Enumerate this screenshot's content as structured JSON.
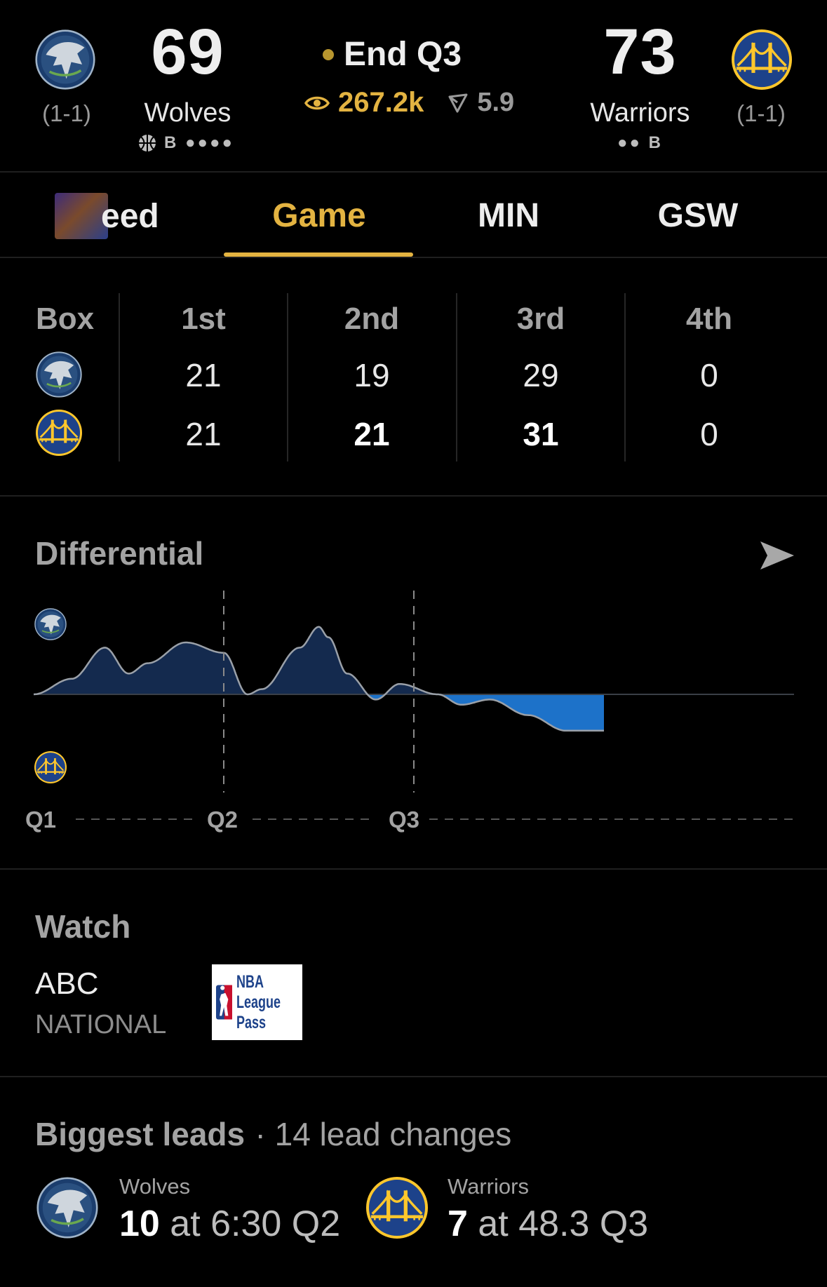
{
  "header": {
    "away": {
      "score": "69",
      "name": "Wolves",
      "record": "(1-1)",
      "possession": "B ●●●●",
      "logo_icon": "timberwolves-logo"
    },
    "home": {
      "score": "73",
      "name": "Warriors",
      "record": "(1-1)",
      "possession": "●● B",
      "logo_icon": "warriors-logo"
    },
    "status": "End Q3",
    "viewers": "267.2k",
    "spread": "5.9"
  },
  "tabs": [
    {
      "label": "eed",
      "active": false
    },
    {
      "label": "Game",
      "active": true
    },
    {
      "label": "MIN",
      "active": false
    },
    {
      "label": "GSW",
      "active": false
    }
  ],
  "box": {
    "label": "Box",
    "periods": [
      "1st",
      "2nd",
      "3rd",
      "4th"
    ],
    "rows": [
      {
        "team": "Wolves",
        "scores": [
          "21",
          "19",
          "29",
          "0"
        ]
      },
      {
        "team": "Warriors",
        "scores": [
          "21",
          "21",
          "31",
          "0"
        ]
      }
    ]
  },
  "differential": {
    "title": "Differential",
    "share_icon": "send-icon",
    "x_labels": [
      "Q1",
      "Q2",
      "Q3"
    ]
  },
  "chart_data": {
    "type": "area",
    "title": "Differential",
    "xlabel": "",
    "ylabel": "",
    "x_ticks": [
      "Q1",
      "Q2",
      "Q3"
    ],
    "x": [
      0,
      0.4,
      0.75,
      1.0,
      1.2,
      1.6,
      2.0,
      2.25,
      2.4,
      2.8,
      3.0,
      3.1,
      3.3,
      3.6,
      3.85,
      4.25,
      4.5,
      4.8,
      5.2,
      5.6,
      6.0
    ],
    "values": [
      0,
      3,
      9,
      4,
      6,
      10,
      8,
      0,
      1,
      9,
      13,
      11,
      4,
      -1,
      2,
      0,
      -2,
      -1,
      -4,
      -7,
      -7
    ],
    "colors": {
      "wolves": "#142a4e",
      "warriors": "#1d72c9",
      "line": "#9aa0a8"
    }
  },
  "watch": {
    "title": "Watch",
    "network": "ABC",
    "scope": "NATIONAL",
    "league_pass": [
      "NBA",
      "League",
      "Pass"
    ]
  },
  "leads": {
    "title": "Biggest leads",
    "subtitle": "· 14 lead changes",
    "away": {
      "team": "Wolves",
      "value": "10",
      "detail": "at 6:30 Q2"
    },
    "home": {
      "team": "Warriors",
      "value": "7",
      "detail": "at 48.3 Q3"
    }
  }
}
